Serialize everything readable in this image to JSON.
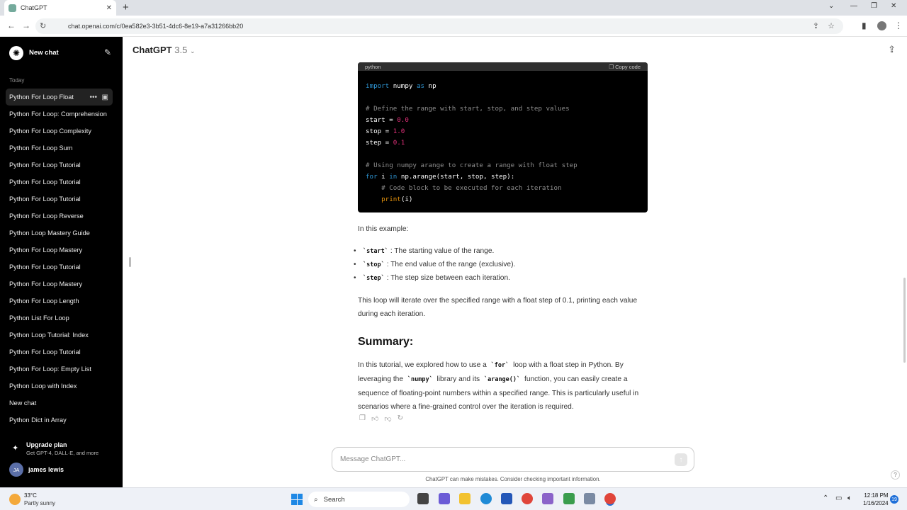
{
  "browser": {
    "tab_title": "ChatGPT",
    "url": "chat.openai.com/c/0ea582e3-3b51-4dc6-8e19-a7a31266bb20"
  },
  "sidebar": {
    "new_chat": "New chat",
    "section_today": "Today",
    "items": [
      "Python For Loop Float",
      "Python For Loop: Comprehension",
      "Python For Loop Complexity",
      "Python For Loop Sum",
      "Python For Loop Tutorial",
      "Python For Loop Tutorial",
      "Python For Loop Tutorial",
      "Python For Loop Reverse",
      "Python Loop Mastery Guide",
      "Python For Loop Mastery",
      "Python For Loop Tutorial",
      "Python For Loop Mastery",
      "Python For Loop Length",
      "Python List For Loop",
      "Python Loop Tutorial: Index",
      "Python For Loop Tutorial",
      "Python For Loop: Empty List",
      "Python Loop with Index",
      "New chat",
      "Python Dict in Array"
    ],
    "upgrade_title": "Upgrade plan",
    "upgrade_sub": "Get GPT-4, DALL·E, and more",
    "user_initials": "JA",
    "user_name": "james lewis"
  },
  "header": {
    "model": "ChatGPT",
    "version": "3.5"
  },
  "code": {
    "language": "python",
    "copy_label": "Copy code"
  },
  "content": {
    "intro": "In this example:",
    "bullets": [
      {
        "code": "`start`",
        "text": ": The starting value of the range."
      },
      {
        "code": "`stop`",
        "text": ": The end value of the range (exclusive)."
      },
      {
        "code": "`step`",
        "text": ": The step size between each iteration."
      }
    ],
    "loop_text": "This loop will iterate over the specified range with a float step of 0.1, printing each value during each iteration.",
    "summary_heading": "Summary:",
    "summary_p1": "In this tutorial, we explored how to use a",
    "summary_code1": "`for`",
    "summary_p2": "loop with a float step in Python. By leveraging the",
    "summary_code2": "`numpy`",
    "summary_p3": "library and its",
    "summary_code3": "`arange()`",
    "summary_p4": "function, you can easily create a sequence of floating-point numbers within a specified range. This is particularly useful in scenarios where a fine-grained control over the iteration is required."
  },
  "composer": {
    "placeholder": "Message ChatGPT...",
    "disclaimer": "ChatGPT can make mistakes. Consider checking important information."
  },
  "taskbar": {
    "temperature": "33°C",
    "condition": "Partly sunny",
    "search": "Search",
    "time": "12:18 PM",
    "date": "1/16/2024",
    "notifications": "19"
  }
}
